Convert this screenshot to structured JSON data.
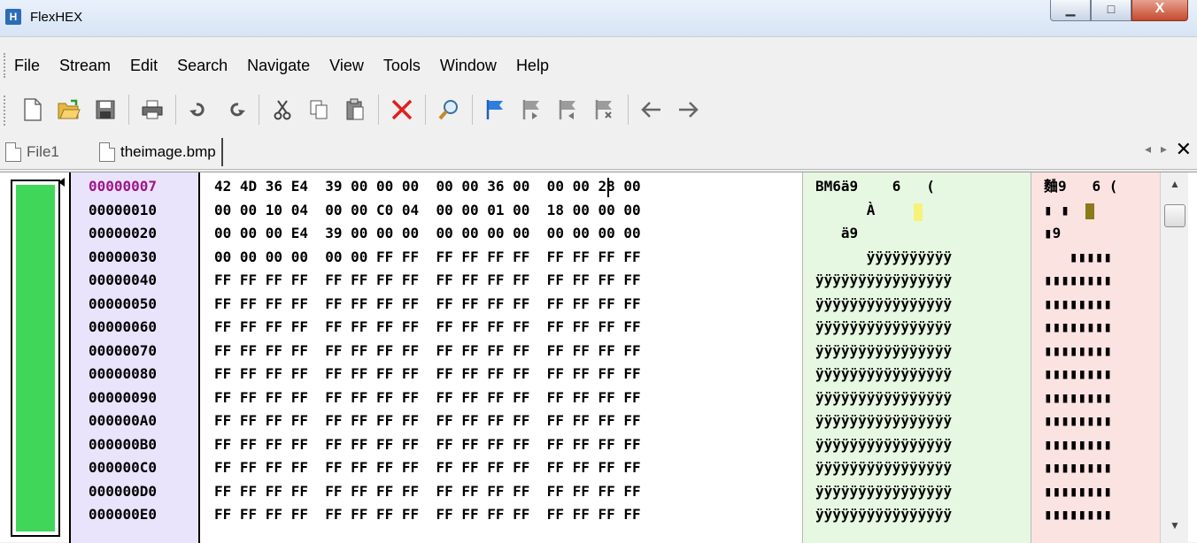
{
  "window": {
    "title": "FlexHEX",
    "app_icon_glyph": "H",
    "minimize_glyph": "▁",
    "maximize_glyph": "□",
    "close_glyph": "X"
  },
  "menu": [
    "File",
    "Stream",
    "Edit",
    "Search",
    "Navigate",
    "View",
    "Tools",
    "Window",
    "Help"
  ],
  "toolbar": {
    "icons": [
      "new-icon",
      "open-folder-icon",
      "save-icon",
      "print-icon",
      "undo-icon",
      "redo-icon",
      "cut-icon",
      "copy-icon",
      "paste-icon",
      "delete-icon",
      "find-icon",
      "bookmark-icon",
      "bookmark-next-icon",
      "bookmark-prev-icon",
      "bookmark-clear-icon",
      "back-icon",
      "forward-icon"
    ]
  },
  "tabs": {
    "items": [
      "File1",
      "theimage.bmp"
    ],
    "active": 1,
    "nav_left": "◂",
    "nav_right": "▸",
    "close": "✕"
  },
  "colors": {
    "address_bg": "#e9e3fb",
    "ascii_bg": "#e7f8e2",
    "unicode_bg": "#fbe3e2",
    "minimap_fill": "#3fd65a",
    "current_address": "#a0168a"
  },
  "editor": {
    "rows": [
      {
        "addr": "00000007",
        "hex": "42 4D 36 E4  39 00 00 00  00 00 36 00  00 00 28 00",
        "ascii": "BM6ä9    6   (",
        "uni": "麯9   6 ("
      },
      {
        "addr": "00000010",
        "hex": "00 00 10 04  00 00 C0 04  00 00 01 00  18 00 00 00",
        "ascii": "      À",
        "uni": "▮ ▮"
      },
      {
        "addr": "00000020",
        "hex": "00 00 00 E4  39 00 00 00  00 00 00 00  00 00 00 00",
        "ascii": "   ä9",
        "uni": "▮9"
      },
      {
        "addr": "00000030",
        "hex": "00 00 00 00  00 00 FF FF  FF FF FF FF  FF FF FF FF",
        "ascii": "      ÿÿÿÿÿÿÿÿÿÿ",
        "uni": "   ▮▮▮▮▮"
      },
      {
        "addr": "00000040",
        "hex": "FF FF FF FF  FF FF FF FF  FF FF FF FF  FF FF FF FF",
        "ascii": "ÿÿÿÿÿÿÿÿÿÿÿÿÿÿÿÿ",
        "uni": "▮▮▮▮▮▮▮▮"
      },
      {
        "addr": "00000050",
        "hex": "FF FF FF FF  FF FF FF FF  FF FF FF FF  FF FF FF FF",
        "ascii": "ÿÿÿÿÿÿÿÿÿÿÿÿÿÿÿÿ",
        "uni": "▮▮▮▮▮▮▮▮"
      },
      {
        "addr": "00000060",
        "hex": "FF FF FF FF  FF FF FF FF  FF FF FF FF  FF FF FF FF",
        "ascii": "ÿÿÿÿÿÿÿÿÿÿÿÿÿÿÿÿ",
        "uni": "▮▮▮▮▮▮▮▮"
      },
      {
        "addr": "00000070",
        "hex": "FF FF FF FF  FF FF FF FF  FF FF FF FF  FF FF FF FF",
        "ascii": "ÿÿÿÿÿÿÿÿÿÿÿÿÿÿÿÿ",
        "uni": "▮▮▮▮▮▮▮▮"
      },
      {
        "addr": "00000080",
        "hex": "FF FF FF FF  FF FF FF FF  FF FF FF FF  FF FF FF FF",
        "ascii": "ÿÿÿÿÿÿÿÿÿÿÿÿÿÿÿÿ",
        "uni": "▮▮▮▮▮▮▮▮"
      },
      {
        "addr": "00000090",
        "hex": "FF FF FF FF  FF FF FF FF  FF FF FF FF  FF FF FF FF",
        "ascii": "ÿÿÿÿÿÿÿÿÿÿÿÿÿÿÿÿ",
        "uni": "▮▮▮▮▮▮▮▮"
      },
      {
        "addr": "000000A0",
        "hex": "FF FF FF FF  FF FF FF FF  FF FF FF FF  FF FF FF FF",
        "ascii": "ÿÿÿÿÿÿÿÿÿÿÿÿÿÿÿÿ",
        "uni": "▮▮▮▮▮▮▮▮"
      },
      {
        "addr": "000000B0",
        "hex": "FF FF FF FF  FF FF FF FF  FF FF FF FF  FF FF FF FF",
        "ascii": "ÿÿÿÿÿÿÿÿÿÿÿÿÿÿÿÿ",
        "uni": "▮▮▮▮▮▮▮▮"
      },
      {
        "addr": "000000C0",
        "hex": "FF FF FF FF  FF FF FF FF  FF FF FF FF  FF FF FF FF",
        "ascii": "ÿÿÿÿÿÿÿÿÿÿÿÿÿÿÿÿ",
        "uni": "▮▮▮▮▮▮▮▮"
      },
      {
        "addr": "000000D0",
        "hex": "FF FF FF FF  FF FF FF FF  FF FF FF FF  FF FF FF FF",
        "ascii": "ÿÿÿÿÿÿÿÿÿÿÿÿÿÿÿÿ",
        "uni": "▮▮▮▮▮▮▮▮"
      },
      {
        "addr": "000000E0",
        "hex": "FF FF FF FF  FF FF FF FF  FF FF FF FF  FF FF FF FF",
        "ascii": "ÿÿÿÿÿÿÿÿÿÿÿÿÿÿÿÿ",
        "uni": "▮▮▮▮▮▮▮▮"
      }
    ]
  },
  "scrollbar": {
    "up": "▲",
    "down": "▼"
  }
}
